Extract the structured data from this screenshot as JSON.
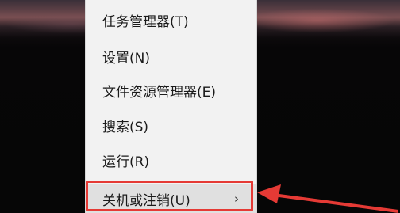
{
  "context_menu": {
    "items": [
      {
        "label": "任务管理器(T)"
      },
      {
        "label": "设置(N)"
      },
      {
        "label": "文件资源管理器(E)"
      },
      {
        "label": "搜索(S)"
      },
      {
        "label": "运行(R)"
      },
      {
        "label": "关机或注销(U)",
        "has_submenu": true,
        "submenu_indicator": "›"
      }
    ]
  },
  "annotation": {
    "highlight_color": "#e53a35",
    "arrow_color": "#e53a35"
  }
}
